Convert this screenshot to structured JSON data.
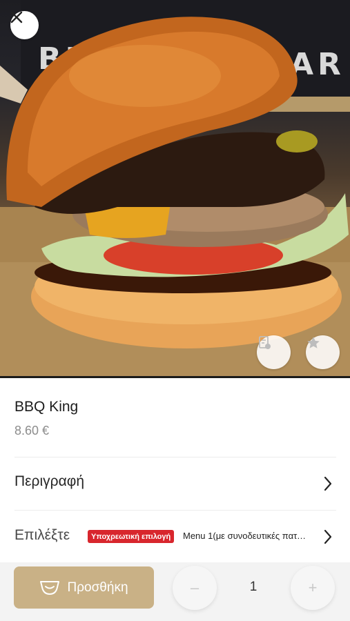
{
  "product": {
    "name": "BBQ King",
    "price": "8.60 €"
  },
  "description_row": {
    "label": "Περιγραφή"
  },
  "choice_row": {
    "label": "Επιλέξτε",
    "required_badge": "Υποχρεωτική επιλογή",
    "selected_text": "Menu 1(με συνοδευτικές πατάτες)"
  },
  "cart": {
    "add_label": "Προσθήκη",
    "quantity": "1",
    "decrement_symbol": "–",
    "increment_symbol": "+"
  },
  "colors": {
    "accent": "#c9b186",
    "required_badge": "#d8262d",
    "price": "#8c8c8c"
  },
  "icons": [
    "close-icon",
    "note-icon",
    "star-icon",
    "chevron-right-icon",
    "basket-icon"
  ]
}
